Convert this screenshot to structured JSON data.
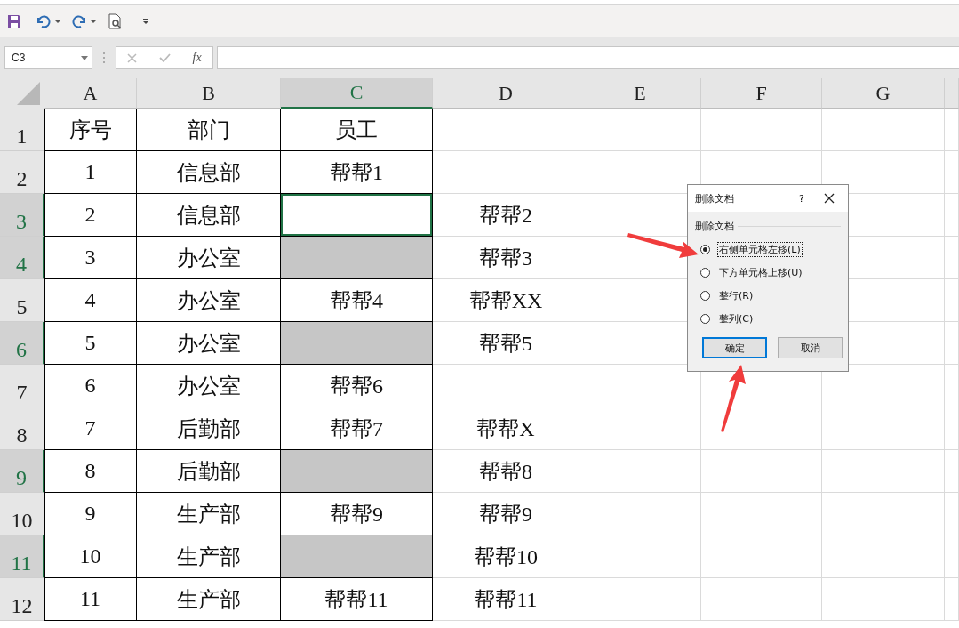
{
  "formula_bar": {
    "name_box": "C3",
    "fx_label": "fx"
  },
  "columns": [
    {
      "label": "A",
      "selected": false
    },
    {
      "label": "B",
      "selected": false
    },
    {
      "label": "C",
      "selected": true
    },
    {
      "label": "D",
      "selected": false
    },
    {
      "label": "E",
      "selected": false
    },
    {
      "label": "F",
      "selected": false
    },
    {
      "label": "G",
      "selected": false
    }
  ],
  "rows": [
    {
      "label": "1",
      "selected": false,
      "cells": [
        {
          "text": "序号",
          "selected": false,
          "active": false
        },
        {
          "text": "部门",
          "selected": false,
          "active": false
        },
        {
          "text": "员工",
          "selected": false,
          "active": false
        },
        {
          "selected": false,
          "active": false
        }
      ]
    },
    {
      "label": "2",
      "selected": false,
      "cells": [
        {
          "text": "1",
          "selected": false,
          "active": false
        },
        {
          "text": "信息部",
          "selected": false,
          "active": false
        },
        {
          "text": "帮帮1",
          "selected": false,
          "active": false
        },
        {
          "selected": false,
          "active": false
        }
      ]
    },
    {
      "label": "3",
      "selected": true,
      "cells": [
        {
          "text": "2",
          "selected": false,
          "active": false
        },
        {
          "text": "信息部",
          "selected": false,
          "active": false
        },
        {
          "selected": true,
          "active": true
        },
        {
          "text": "帮帮2",
          "selected": false,
          "active": false
        }
      ]
    },
    {
      "label": "4",
      "selected": true,
      "cells": [
        {
          "text": "3",
          "selected": false,
          "active": false
        },
        {
          "text": "办公室",
          "selected": false,
          "active": false
        },
        {
          "selected": true,
          "active": false
        },
        {
          "text": "帮帮3",
          "selected": false,
          "active": false
        }
      ]
    },
    {
      "label": "5",
      "selected": false,
      "cells": [
        {
          "text": "4",
          "selected": false,
          "active": false
        },
        {
          "text": "办公室",
          "selected": false,
          "active": false
        },
        {
          "text": "帮帮4",
          "selected": false,
          "active": false
        },
        {
          "text": "帮帮XX",
          "selected": false,
          "active": false
        }
      ]
    },
    {
      "label": "6",
      "selected": true,
      "cells": [
        {
          "text": "5",
          "selected": false,
          "active": false
        },
        {
          "text": "办公室",
          "selected": false,
          "active": false
        },
        {
          "selected": true,
          "active": false
        },
        {
          "text": "帮帮5",
          "selected": false,
          "active": false
        }
      ]
    },
    {
      "label": "7",
      "selected": false,
      "cells": [
        {
          "text": "6",
          "selected": false,
          "active": false
        },
        {
          "text": "办公室",
          "selected": false,
          "active": false
        },
        {
          "text": "帮帮6",
          "selected": false,
          "active": false
        },
        {
          "selected": false,
          "active": false
        }
      ]
    },
    {
      "label": "8",
      "selected": false,
      "cells": [
        {
          "text": "7",
          "selected": false,
          "active": false
        },
        {
          "text": "后勤部",
          "selected": false,
          "active": false
        },
        {
          "text": "帮帮7",
          "selected": false,
          "active": false
        },
        {
          "text": "帮帮X",
          "selected": false,
          "active": false
        }
      ]
    },
    {
      "label": "9",
      "selected": true,
      "cells": [
        {
          "text": "8",
          "selected": false,
          "active": false
        },
        {
          "text": "后勤部",
          "selected": false,
          "active": false
        },
        {
          "selected": true,
          "active": false
        },
        {
          "text": "帮帮8",
          "selected": false,
          "active": false
        }
      ]
    },
    {
      "label": "10",
      "selected": false,
      "cells": [
        {
          "text": "9",
          "selected": false,
          "active": false
        },
        {
          "text": "生产部",
          "selected": false,
          "active": false
        },
        {
          "text": "帮帮9",
          "selected": false,
          "active": false
        },
        {
          "text": "帮帮9",
          "selected": false,
          "active": false
        }
      ]
    },
    {
      "label": "11",
      "selected": true,
      "cells": [
        {
          "text": "10",
          "selected": false,
          "active": false
        },
        {
          "text": "生产部",
          "selected": false,
          "active": false
        },
        {
          "selected": true,
          "active": false
        },
        {
          "text": "帮帮10",
          "selected": false,
          "active": false
        }
      ]
    },
    {
      "label": "12",
      "selected": false,
      "cells": [
        {
          "text": "11",
          "selected": false,
          "active": false
        },
        {
          "text": "生产部",
          "selected": false,
          "active": false
        },
        {
          "text": "帮帮11",
          "selected": false,
          "active": false
        },
        {
          "text": "帮帮11",
          "selected": false,
          "active": false
        }
      ]
    }
  ],
  "dialog": {
    "title": "删除文档",
    "help": "?",
    "group_label": "删除文档",
    "options": [
      {
        "label": "右侧单元格左移(L)",
        "selected": true
      },
      {
        "label": "下方单元格上移(U)",
        "selected": false
      },
      {
        "label": "整行(R)",
        "selected": false
      },
      {
        "label": "整列(C)",
        "selected": false
      }
    ],
    "buttons": [
      {
        "label": "确定",
        "default": true
      },
      {
        "label": "取消",
        "default": false
      }
    ]
  }
}
